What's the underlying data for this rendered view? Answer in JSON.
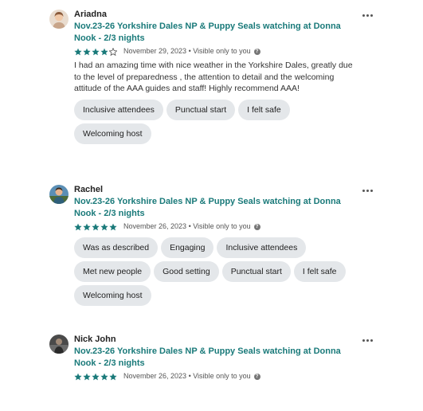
{
  "colors": {
    "accent": "#1a7a7a",
    "tag_bg": "#e4e7ea",
    "star": "#1a7a7a",
    "text": "#222222"
  },
  "reviews": [
    {
      "name": "Ariadna",
      "title": "Nov.23-26 Yorkshire Dales NP & Puppy Seals watching at Donna Nook - 2/3 nights",
      "rating": 4,
      "date": "November 29, 2023",
      "visibility": "Visible only to you",
      "text": "I had an amazing time with nice weather in the Yorkshire Dales, greatly due to the level of preparedness , the attention to detail and the welcoming attitude of the AAA guides and staff! Highly recommend AAA!",
      "tags": [
        "Inclusive attendees",
        "Punctual start",
        "I felt safe",
        "Welcoming host"
      ]
    },
    {
      "name": "Rachel",
      "title": "Nov.23-26 Yorkshire Dales NP & Puppy Seals watching at Donna Nook - 2/3 nights",
      "rating": 5,
      "date": "November 26, 2023",
      "visibility": "Visible only to you",
      "text": "",
      "tags": [
        "Was as described",
        "Engaging",
        "Inclusive attendees",
        "Met new people",
        "Good setting",
        "Punctual start",
        "I felt safe",
        "Welcoming host"
      ]
    },
    {
      "name": "Nick John",
      "title": "Nov.23-26 Yorkshire Dales NP & Puppy Seals watching at Donna Nook - 2/3 nights",
      "rating": 5,
      "date": "November 26, 2023",
      "visibility": "Visible only to you",
      "text": "",
      "tags": []
    }
  ],
  "icons": {
    "more": "more-options-icon",
    "info": "info-icon",
    "star": "star-icon"
  },
  "info_glyph": "?"
}
